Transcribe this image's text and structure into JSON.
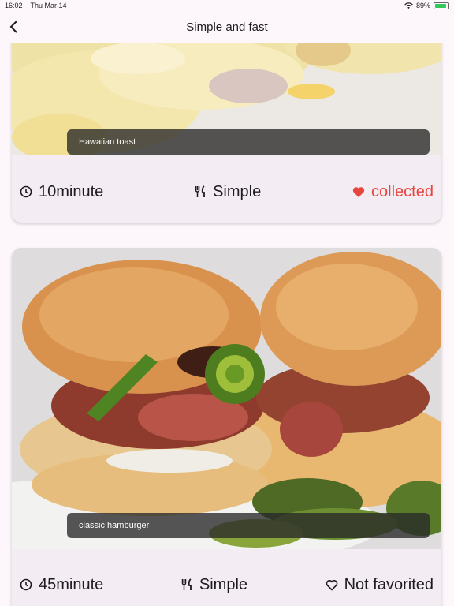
{
  "status_bar": {
    "time": "16:02",
    "date": "Thu Mar 14",
    "battery_percent": "89%",
    "battery_level": 0.89
  },
  "appbar": {
    "title": "Simple and fast",
    "back_icon": "chevron-left-icon"
  },
  "recipes": [
    {
      "name": "Hawaiian toast",
      "time": "10minute",
      "difficulty": "Simple",
      "favorite_label": "collected",
      "favorited": true,
      "image_desc": "toast with melted cheese"
    },
    {
      "name": "classic hamburger",
      "time": "45minute",
      "difficulty": "Simple",
      "favorite_label": "Not favorited",
      "favorited": false,
      "image_desc": "burgers with bacon, jalapeno and pickles"
    }
  ],
  "colors": {
    "background": "#fdf7fb",
    "card": "#f3ecf3",
    "favorite_accent": "#e8453c",
    "text": "#1d1b20"
  }
}
